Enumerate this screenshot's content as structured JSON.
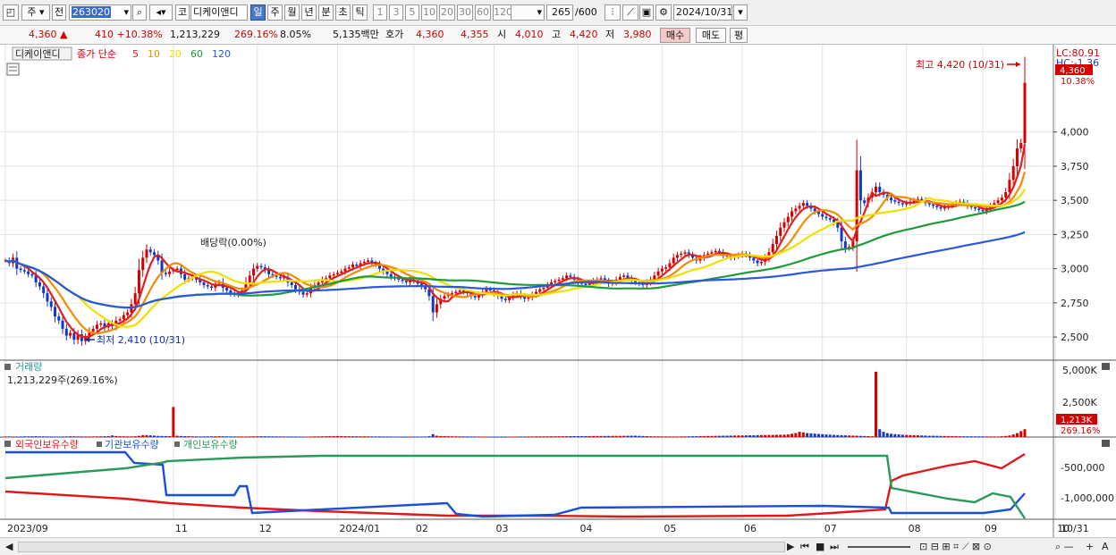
{
  "toolbar": {
    "market": "주",
    "compare": "전",
    "code": "263020",
    "name_tag": "코",
    "name": "디케이앤디",
    "periods": [
      "일",
      "주",
      "월",
      "년",
      "분",
      "초",
      "틱"
    ],
    "selected_period": "일",
    "intervals": [
      "1",
      "3",
      "5",
      "10",
      "20",
      "30",
      "60",
      "120"
    ],
    "count": "265",
    "count_total": "/600",
    "date": "2024/10/31"
  },
  "info": {
    "price": "4,360",
    "arrow": "▲",
    "change": "410",
    "change_pct": "+10.38%",
    "volume": "1,213,229",
    "volume_pct": "269.16%",
    "turnover": "8.05%",
    "amount": "5,135백만",
    "bid_label": "호가",
    "bid1": "4,360",
    "bid2": "4,355",
    "open_label": "시",
    "open": "4,010",
    "high_label": "고",
    "high": "4,420",
    "low_label": "저",
    "low": "3,980",
    "buy": "매수",
    "sell": "매도",
    "avg": "평"
  },
  "colors": {
    "up": "#d40000",
    "down": "#1038c8",
    "ma5": "#e02020",
    "ma10": "#f28c00",
    "ma20": "#f0e000",
    "ma60": "#1e9a3a",
    "ma120": "#2a58d8",
    "foreign": "#e01818",
    "inst": "#1a4fd8",
    "indiv": "#2a9a5a"
  },
  "legend": {
    "stock": "디케이앤디",
    "close_label": "종가 단순",
    "ma": [
      "5",
      "10",
      "20",
      "60",
      "120"
    ]
  },
  "annotations": {
    "high": "최고 4,420 (10/31)",
    "low": "최저 2,410 (10/31)",
    "dividend": "배당락(0.00%)",
    "right_top": "LC:80.91",
    "right_top2": "HC:-1.36",
    "last_price": "4,360",
    "last_pct": "10.38%"
  },
  "price_axis": [
    "4,000",
    "3,750",
    "3,500",
    "3,250",
    "3,000",
    "2,750",
    "2,500"
  ],
  "volume_panel": {
    "title": "거래량",
    "value": "1,213,229주(269.16%)",
    "axis": [
      "5,000K",
      "2,500K"
    ],
    "last": "1,213K",
    "last_pct": "269.16%"
  },
  "holding_panel": {
    "foreign": "외국인보유수량",
    "inst": "기관보유수량",
    "indiv": "개인보유수량",
    "axis": [
      "-500,000",
      "-1,000,000"
    ]
  },
  "x_axis": [
    "2023/09",
    "11",
    "12",
    "2024/01",
    "02",
    "03",
    "04",
    "05",
    "06",
    "07",
    "08",
    "09",
    "10"
  ],
  "x_axis_end": "10/31",
  "chart_data": {
    "type": "candlestick",
    "ylim": [
      2350,
      4600
    ],
    "close": [
      3060,
      3040,
      3080,
      3000,
      2990,
      2980,
      2960,
      2950,
      2900,
      2870,
      2820,
      2760,
      2720,
      2650,
      2620,
      2560,
      2510,
      2530,
      2480,
      2520,
      2470,
      2500,
      2540,
      2560,
      2590,
      2600,
      2570,
      2600,
      2580,
      2620,
      2630,
      2660,
      2680,
      2740,
      2820,
      2990,
      3080,
      3140,
      3120,
      3100,
      3060,
      2970,
      2960,
      2980,
      2990,
      3000,
      2960,
      2920,
      2930,
      2940,
      2920,
      2900,
      2880,
      2870,
      2860,
      2890,
      2900,
      2860,
      2840,
      2820,
      2810,
      2820,
      2840,
      2900,
      2950,
      3000,
      3020,
      3010,
      2990,
      2960,
      2950,
      2940,
      2930,
      2940,
      2900,
      2880,
      2850,
      2830,
      2810,
      2820,
      2860,
      2880,
      2900,
      2920,
      2930,
      2950,
      2960,
      2970,
      2980,
      3000,
      3010,
      3030,
      3020,
      3040,
      3050,
      3060,
      3040,
      3030,
      3000,
      2980,
      2960,
      2940,
      2930,
      2920,
      2910,
      2900,
      2920,
      2910,
      2890,
      2870,
      2850,
      2800,
      2680,
      2740,
      2780,
      2800,
      2810,
      2820,
      2830,
      2840,
      2830,
      2820,
      2800,
      2790,
      2810,
      2830,
      2850,
      2840,
      2820,
      2800,
      2780,
      2770,
      2790,
      2810,
      2820,
      2800,
      2780,
      2790,
      2810,
      2830,
      2850,
      2860,
      2880,
      2900,
      2910,
      2920,
      2930,
      2950,
      2940,
      2920,
      2900,
      2890,
      2880,
      2890,
      2910,
      2920,
      2930,
      2910,
      2890,
      2900,
      2920,
      2940,
      2950,
      2930,
      2910,
      2900,
      2890,
      2880,
      2900,
      2920,
      2950,
      2980,
      3000,
      3010,
      3040,
      3080,
      3100,
      3110,
      3120,
      3100,
      3080,
      3060,
      3080,
      3100,
      3110,
      3120,
      3130,
      3120,
      3100,
      3090,
      3080,
      3090,
      3100,
      3110,
      3100,
      3080,
      3060,
      3040,
      3050,
      3080,
      3120,
      3180,
      3240,
      3300,
      3340,
      3380,
      3420,
      3440,
      3460,
      3480,
      3460,
      3440,
      3420,
      3400,
      3380,
      3370,
      3360,
      3340,
      3300,
      3200,
      3150,
      3160,
      3200,
      3720,
      3500,
      3480,
      3520,
      3560,
      3600,
      3560,
      3540,
      3520,
      3500,
      3490,
      3480,
      3470,
      3480,
      3490,
      3500,
      3510,
      3500,
      3480,
      3470,
      3460,
      3450,
      3440,
      3450,
      3460,
      3470,
      3480,
      3490,
      3480,
      3460,
      3450,
      3440,
      3430,
      3420,
      3440,
      3460,
      3480,
      3500,
      3520,
      3560,
      3650,
      3750,
      3880,
      3920,
      4360
    ],
    "volume_k": [
      40,
      45,
      40,
      38,
      42,
      50,
      48,
      55,
      60,
      52,
      48,
      44,
      40,
      38,
      36,
      40,
      45,
      60,
      55,
      48,
      44,
      40,
      42,
      46,
      50,
      55,
      60,
      70,
      120,
      80,
      60,
      55,
      50,
      48,
      60,
      90,
      140,
      150,
      130,
      110,
      90,
      80,
      75,
      70,
      2300,
      100,
      80,
      70,
      60,
      55,
      50,
      45,
      48,
      52,
      55,
      58,
      60,
      55,
      50,
      48,
      46,
      44,
      42,
      40,
      45,
      50,
      55,
      60,
      58,
      54,
      50,
      48,
      46,
      44,
      42,
      40,
      38,
      36,
      34,
      32,
      40,
      45,
      50,
      55,
      60,
      65,
      70,
      75,
      70,
      65,
      60,
      58,
      56,
      54,
      52,
      50,
      48,
      46,
      44,
      42,
      40,
      38,
      36,
      34,
      32,
      30,
      32,
      34,
      36,
      38,
      40,
      60,
      220,
      100,
      80,
      70,
      60,
      55,
      50,
      48,
      46,
      44,
      42,
      40,
      38,
      36,
      34,
      32,
      30,
      28,
      30,
      32,
      34,
      36,
      38,
      40,
      42,
      44,
      46,
      48,
      50,
      52,
      54,
      56,
      58,
      60,
      62,
      64,
      66,
      68,
      70,
      72,
      74,
      76,
      78,
      80,
      82,
      84,
      86,
      88,
      90,
      92,
      94,
      96,
      98,
      100,
      90,
      80,
      70,
      60,
      55,
      50,
      48,
      46,
      44,
      42,
      40,
      45,
      50,
      55,
      60,
      65,
      70,
      75,
      80,
      85,
      90,
      95,
      100,
      105,
      110,
      115,
      120,
      125,
      130,
      135,
      140,
      145,
      150,
      155,
      160,
      165,
      170,
      175,
      180,
      200,
      250,
      300,
      400,
      350,
      300,
      280,
      260,
      240,
      220,
      200,
      180,
      160,
      150,
      140,
      130,
      120,
      110,
      100,
      90,
      80,
      70,
      60,
      5000,
      600,
      400,
      300,
      250,
      220,
      200,
      180,
      160,
      150,
      140,
      130,
      120,
      110,
      100,
      95,
      90,
      85,
      80,
      75,
      70,
      65,
      60,
      58,
      56,
      54,
      52,
      50,
      48,
      46,
      44,
      42,
      40,
      60,
      80,
      120,
      200,
      300,
      450,
      600,
      1213
    ]
  }
}
